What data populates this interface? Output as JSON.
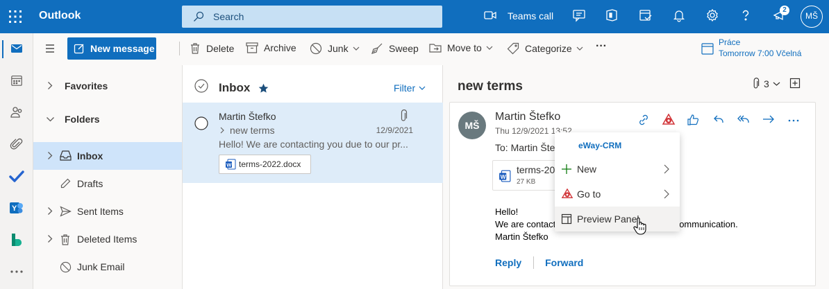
{
  "colors": {
    "brand": "#106ebe",
    "selected_bg": "#cfe4fa",
    "eway_red": "#d13438"
  },
  "topbar": {
    "app_name": "Outlook",
    "search_placeholder": "Search",
    "teams_call_label": "Teams call",
    "notification_count": "2",
    "user_initials": "MŠ",
    "icons": [
      "waffle-icon",
      "teams-call-icon",
      "chat-icon",
      "office-icon",
      "my-day-icon",
      "bell-icon",
      "gear-icon",
      "help-icon",
      "feedback-icon"
    ]
  },
  "rail": {
    "items": [
      "mail-icon",
      "calendar-icon",
      "people-icon",
      "files-icon",
      "todo-icon",
      "yammer-icon",
      "bookings-icon",
      "more-apps-icon"
    ]
  },
  "commands": {
    "new_message": "New message",
    "delete": "Delete",
    "archive": "Archive",
    "junk": "Junk",
    "sweep": "Sweep",
    "move_to": "Move to",
    "categorize": "Categorize",
    "more": "···",
    "reminder_title": "Práce",
    "reminder_time": "Tomorrow 7:00 Včelná"
  },
  "folders": {
    "favorites": "Favorites",
    "folders": "Folders",
    "items": [
      {
        "label": "Inbox",
        "icon": "inbox-icon"
      },
      {
        "label": "Drafts",
        "icon": "pencil-icon"
      },
      {
        "label": "Sent Items",
        "icon": "send-icon"
      },
      {
        "label": "Deleted Items",
        "icon": "trash-icon"
      },
      {
        "label": "Junk Email",
        "icon": "block-icon"
      }
    ]
  },
  "message_list": {
    "title": "Inbox",
    "filter_label": "Filter",
    "item": {
      "sender": "Martin Štefko",
      "subject": "new terms",
      "date": "12/9/2021",
      "preview": "Hello! We are contacting you due to our pr...",
      "attachment": "terms-2022.docx"
    }
  },
  "reading": {
    "subject": "new terms",
    "attachment_count": "3",
    "sender": "Martin Štefko",
    "sender_initials": "MŠ",
    "datetime": "Thu 12/9/2021 13:52",
    "to": "To: Martin Štefko",
    "attachment_name": "terms-20",
    "attachment_size": "27 KB",
    "body_line1": "Hello!",
    "body_line2_start": "We are contact",
    "body_line2_end": "ommunication.",
    "body_line3": "Martin Štefko",
    "reply": "Reply",
    "forward": "Forward"
  },
  "eway_menu": {
    "title": "eWay-CRM",
    "items": [
      {
        "label": "New",
        "icon": "plus-icon",
        "submenu": true
      },
      {
        "label": "Go to",
        "icon": "eway-icon",
        "submenu": true
      },
      {
        "label": "Preview Panel",
        "icon": "panel-icon",
        "submenu": false
      }
    ]
  }
}
